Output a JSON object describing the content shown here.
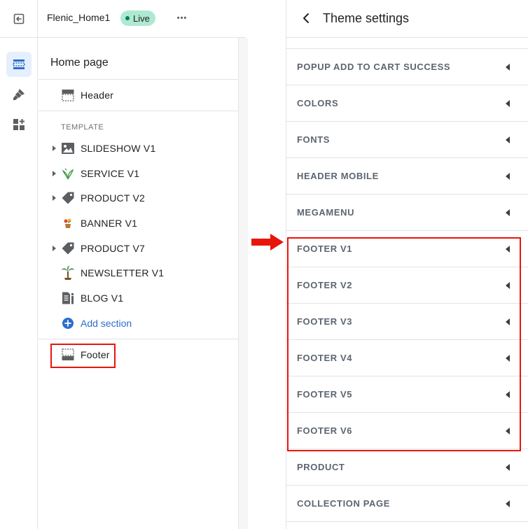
{
  "topbar": {
    "store_name": "Flenic_Home1",
    "live_badge": "Live",
    "more": "•••"
  },
  "left_panel": {
    "title": "Home page",
    "header_item": "Header",
    "template_label": "TEMPLATE",
    "sections": [
      {
        "label": "SLIDESHOW V1",
        "icon": "image-icon",
        "expandable": true
      },
      {
        "label": "SERVICE V1",
        "icon": "plant-icon",
        "expandable": true
      },
      {
        "label": "PRODUCT V2",
        "icon": "tag-icon",
        "expandable": true
      },
      {
        "label": "BANNER V1",
        "icon": "flower-pot-icon",
        "expandable": false
      },
      {
        "label": "PRODUCT V7",
        "icon": "tag-icon",
        "expandable": true
      },
      {
        "label": "NEWSLETTER V1",
        "icon": "palm-tree-icon",
        "expandable": false
      },
      {
        "label": "BLOG V1",
        "icon": "blog-icon",
        "expandable": false
      }
    ],
    "add_section": "Add section",
    "footer_item": "Footer"
  },
  "right_panel": {
    "title": "Theme settings",
    "items": [
      "POPUP ADD TO CART SUCCESS",
      "COLORS",
      "FONTS",
      "HEADER MOBILE",
      "MEGAMENU",
      "FOOTER V1",
      "FOOTER V2",
      "FOOTER V3",
      "FOOTER V4",
      "FOOTER V5",
      "FOOTER V6",
      "PRODUCT",
      "COLLECTION PAGE"
    ]
  },
  "colors": {
    "accent_blue": "#2c6ecb",
    "live_badge_bg": "#aee9d1",
    "highlight_red": "#e8150b"
  }
}
